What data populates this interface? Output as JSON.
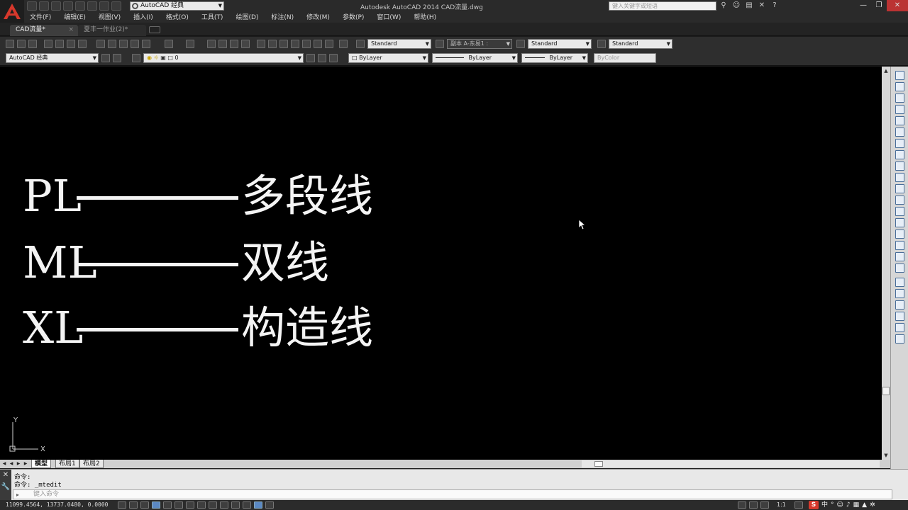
{
  "titlebar": {
    "workspace": "AutoCAD 经典",
    "window_title": "Autodesk AutoCAD 2014    CAD流量.dwg",
    "search_placeholder": "键入关键字或短语",
    "icons": [
      "search-icon",
      "user-icon",
      "cart-icon",
      "exchange-icon",
      "help-icon"
    ],
    "window_controls": [
      "minimize-icon",
      "restore-icon",
      "close-icon"
    ]
  },
  "menu": [
    "文件(F)",
    "编辑(E)",
    "视图(V)",
    "插入(I)",
    "格式(O)",
    "工具(T)",
    "绘图(D)",
    "标注(N)",
    "修改(M)",
    "参数(P)",
    "窗口(W)",
    "帮助(H)"
  ],
  "tabs": [
    {
      "label": "CAD流量*",
      "active": true
    },
    {
      "label": "夏丰一作业(2)*",
      "active": false
    }
  ],
  "toolbar1": {
    "text_style": "Standard",
    "dim_style": "副本 A-东易1 :",
    "table_style": "Standard",
    "mleader_style": "Standard"
  },
  "toolbar2": {
    "workspace": "AutoCAD 经典",
    "layer": "0",
    "color": "ByLayer",
    "linetype": "ByLayer",
    "lineweight": "ByLayer",
    "plotstyle": "ByColor"
  },
  "canvas": {
    "background": "#000000",
    "rows": [
      {
        "command": "PL",
        "meaning": "多段线"
      },
      {
        "command": "ML",
        "meaning": "双线"
      },
      {
        "command": "XL",
        "meaning": "构造线"
      }
    ],
    "ucs": {
      "x_label": "X",
      "y_label": "Y"
    }
  },
  "layout_tabs": [
    {
      "label": "模型",
      "active": true
    },
    {
      "label": "布局1",
      "active": false
    },
    {
      "label": "布局2",
      "active": false
    }
  ],
  "command_window": {
    "history": [
      "命令:",
      "命令:  _mtedit"
    ],
    "input_placeholder": "键入命令"
  },
  "statusbar": {
    "coordinates": "11099.4564, 13737.0480, 0.0000",
    "scale": "1:1",
    "ime_lang": "中",
    "ime_logo": "S"
  }
}
